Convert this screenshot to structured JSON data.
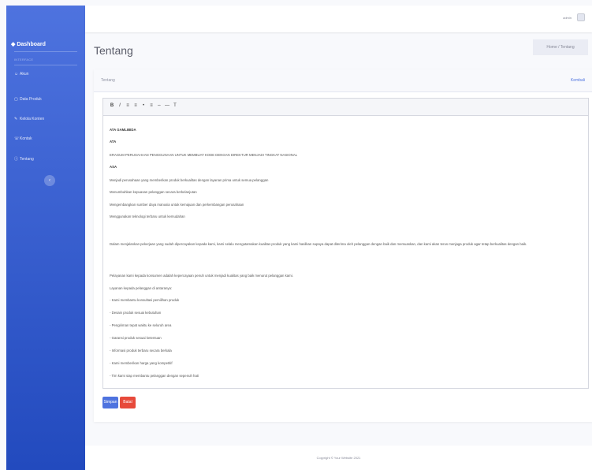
{
  "sidebar": {
    "brand": "Dashboard",
    "heading": "INTERFACE",
    "items": [
      {
        "label": "Akun",
        "icon": "user-icon"
      },
      {
        "label": "Data Produk",
        "icon": "box-icon"
      },
      {
        "label": "Kelola Konten",
        "icon": "edit-icon"
      },
      {
        "label": "Kontak",
        "icon": "phone-icon"
      },
      {
        "label": "Tentang",
        "icon": "info-icon"
      }
    ],
    "toggle_glyph": "‹"
  },
  "topbar": {
    "user_name": "admin"
  },
  "page": {
    "title": "Tentang",
    "breadcrumb": "Home / Tentang"
  },
  "card": {
    "title": "Tentang",
    "link": "Kembali"
  },
  "toolbar": {
    "glyphs": [
      "B",
      "I",
      "≡",
      "≡",
      "•",
      "≡",
      "⇔",
      "—",
      "T"
    ]
  },
  "editor": {
    "line1": "ATA GAMLIBIDA",
    "line2": "ATA",
    "line3": "ERAGUM PERUSAHAAN PENGGUNAAN UNTUK MEMBUAT KODE DENGAN DIREKTUR MENJADI TINGKAT NASIONAL",
    "line4": "ASA",
    "line5": "Menjadi perusahaan yang memberikan produk berkualitas dengan layanan prima untuk semua pelanggan",
    "line6": "Menumbuhkan kepuasan pelanggan secara berkelanjutan",
    "line7": "Mengembangkan sumber daya manusia untuk kemajuan dan perkembangan perusahaan",
    "line8": "Menggunakan teknologi terbaru untuk kemudahan",
    "para1": "Dalam menjalankan pekerjaan yang sudah dipercayakan kepada kami, kami selalu mengutamakan kualitas produk yang kami hasilkan supaya dapat diterima oleh pelanggan dengan baik dan memuaskan, dan kami akan terus menjaga produk agar tetap berkualitas dengan baik.",
    "para2": "Pelayanan kami kepada konsumen adalah kepercayaan penuh untuk menjadi kualitas yang baik menurut pelanggan kami.",
    "list_heading": "Layanan kepada pelanggan di antaranya:",
    "bullets": [
      "- Kami membantu konsultasi pemilihan produk",
      "- Desain produk sesuai kebutuhan",
      "- Pengiriman tepat waktu ke seluruh area",
      "- Garansi produk sesuai ketentuan",
      "- Informasi produk terbaru secara berkala",
      "- Kami memberikan harga yang kompetitif",
      "- Tim kami siap membantu pelanggan dengan sepenuh hati"
    ]
  },
  "buttons": {
    "save": "Simpan",
    "cancel": "Batal"
  },
  "footer": {
    "copyright": "Copyright © Your Website 2021"
  },
  "colors": {
    "primary": "#4e73df",
    "danger": "#e74a3b",
    "sidebar_end": "#224abe"
  }
}
